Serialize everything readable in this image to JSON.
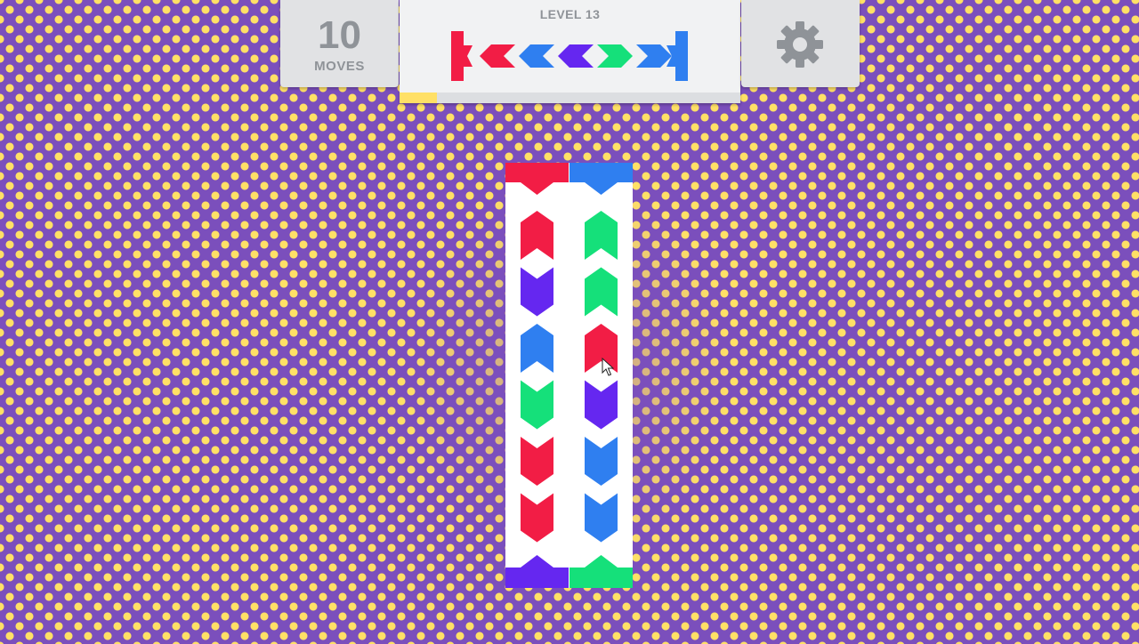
{
  "hud": {
    "moves": {
      "count": "10",
      "label": "MOVES"
    },
    "level": {
      "label": "LEVEL 13",
      "progress": 0.11,
      "progress_color": "#ffe066",
      "target_sequence": [
        "red",
        "blue",
        "purple",
        "green",
        "blue"
      ],
      "target_left_cap": "red",
      "target_right_cap": "blue"
    },
    "settings": {
      "icon": "gear-icon",
      "color": "#8f9398"
    }
  },
  "colors": {
    "red": "#f21d45",
    "blue": "#2f7ff0",
    "purple": "#6527f0",
    "green": "#15e07a",
    "background": "#7b4fbc",
    "dots": "#ffe066"
  },
  "board": {
    "columns": [
      {
        "top_cap": "red",
        "bottom_cap": "purple",
        "pieces": [
          {
            "color": "red",
            "direction": "up"
          },
          {
            "color": "purple",
            "direction": "down"
          },
          {
            "color": "blue",
            "direction": "up"
          },
          {
            "color": "green",
            "direction": "down"
          },
          {
            "color": "red",
            "direction": "down"
          },
          {
            "color": "red",
            "direction": "down"
          }
        ]
      },
      {
        "top_cap": "blue",
        "bottom_cap": "green",
        "pieces": [
          {
            "color": "green",
            "direction": "up"
          },
          {
            "color": "green",
            "direction": "up"
          },
          {
            "color": "red",
            "direction": "up"
          },
          {
            "color": "purple",
            "direction": "down"
          },
          {
            "color": "blue",
            "direction": "down"
          },
          {
            "color": "blue",
            "direction": "down"
          }
        ]
      }
    ]
  }
}
